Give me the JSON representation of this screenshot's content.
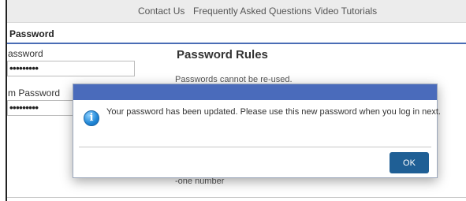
{
  "nav": {
    "contact_us": "Contact Us",
    "faq": "Frequently Asked Questions",
    "video_tutorials": "Video Tutorials"
  },
  "section": {
    "title": "Password"
  },
  "form": {
    "new_password_label": "assword",
    "new_password_value": "•••••••••",
    "confirm_password_label": "m Password",
    "confirm_password_value": "•••••••••"
  },
  "rules": {
    "title": "Password Rules",
    "line1": "Passwords cannot be re-used.",
    "line_last": "-one number"
  },
  "dialog": {
    "icon": "info-icon",
    "icon_glyph": "i",
    "message": "Your password has been updated. Please use this new password when you log in next.",
    "ok_label": "OK"
  },
  "colors": {
    "accent": "#4a6bbb",
    "button": "#1f5f95",
    "header_underline": "#4a6db5"
  }
}
